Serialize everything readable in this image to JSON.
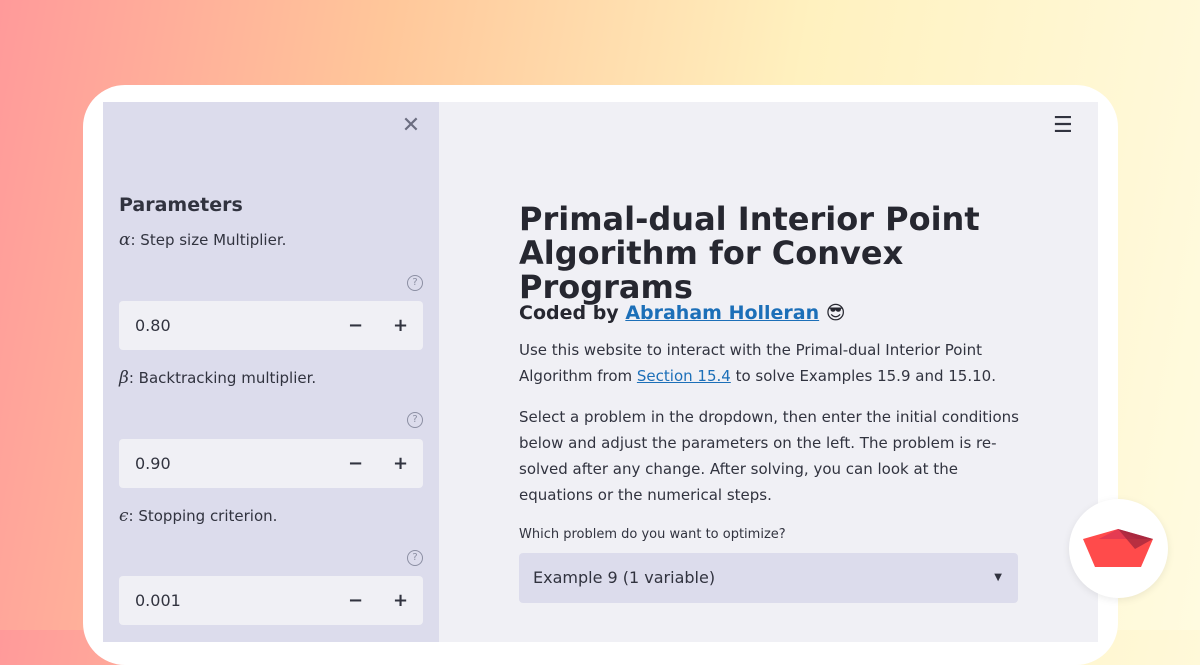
{
  "sidebar": {
    "close_icon": "close-icon",
    "title": "Parameters",
    "params": [
      {
        "symbol": "α",
        "label": ": Step size Multiplier.",
        "value": "0.80",
        "help_icon": "help-circle-icon"
      },
      {
        "symbol": "β",
        "label": ": Backtracking multiplier.",
        "value": "0.90",
        "help_icon": "help-circle-icon"
      },
      {
        "symbol": "ϵ",
        "label": ": Stopping criterion.",
        "value": "0.001",
        "help_icon": "help-circle-icon"
      }
    ],
    "minus_label": "−",
    "plus_label": "+"
  },
  "header": {
    "menu_icon": "hamburger-menu-icon"
  },
  "main": {
    "title": "Primal-dual Interior Point Algorithm for Convex Programs",
    "byline_prefix": "Coded by ",
    "author": "Abraham Holleran",
    "emoji": "😎",
    "para1_before": "Use this website to interact with the Primal-dual Interior Point Algorithm from ",
    "para1_link": "Section 15.4",
    "para1_after": " to solve Examples 15.9 and 15.10.",
    "para2": "Select a problem in the dropdown, then enter the initial conditions below and adjust the parameters on the left. The problem is re-solved after any change. After solving, you can look at the equations or the numerical steps.",
    "select_label": "Which problem do you want to optimize?",
    "select_value": "Example 9 (1 variable)"
  },
  "brand": {
    "logo_icon": "streamlit-logo-icon"
  },
  "colors": {
    "accent_link": "#1c6fb8",
    "sidebar_bg": "#dcdcec",
    "main_bg": "#f0f0f5",
    "logo_red": "#ff4b4b"
  }
}
